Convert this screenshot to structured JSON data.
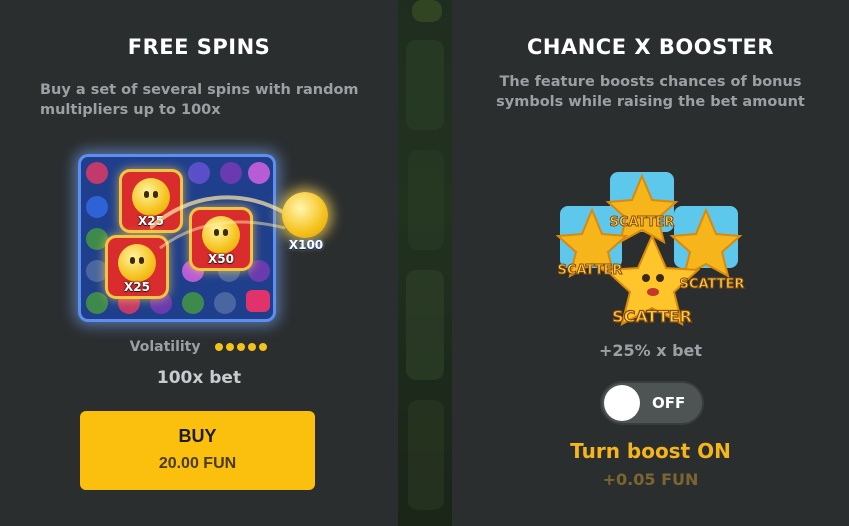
{
  "free_spins": {
    "title": "FREE SPINS",
    "description": "Buy a set of several spins with random multipliers up to 100x",
    "multipliers": [
      "X25",
      "X50",
      "X25",
      "X100"
    ],
    "volatility_label": "Volatility",
    "volatility_level": 5,
    "volatility_max": 5,
    "bet_multiplier": "100x bet",
    "buy_label": "BUY",
    "buy_price": "20.00 FUN"
  },
  "chance_booster": {
    "title": "CHANCE X BOOSTER",
    "description": "The feature boosts chances of bonus symbols while raising the bet amount",
    "scatter_labels": [
      "SCATTER",
      "SCATTER",
      "SCATTER",
      "SCATTER"
    ],
    "bet_increase": "+25% x bet",
    "toggle_state": "OFF",
    "boost_prompt": "Turn boost ON",
    "boost_cost": "+0.05 FUN"
  },
  "colors": {
    "panel": "#2b2e2f",
    "accent": "#fbbf0e",
    "boost": "#f5b51c"
  }
}
